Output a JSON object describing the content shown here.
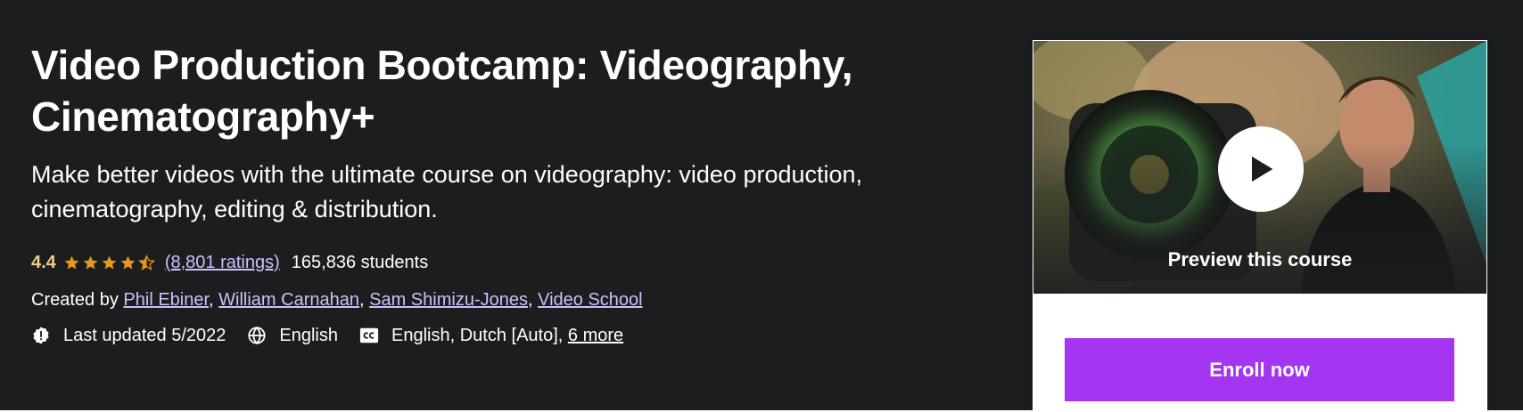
{
  "course": {
    "title": "Video Production Bootcamp: Videography, Cinematography+",
    "subtitle": "Make better videos with the ultimate course on videography: video production, cinematography, editing & distribution.",
    "rating": "4.4",
    "rating_value": 4.4,
    "rating_max": 5,
    "ratings_link": "(8,801 ratings)",
    "students": "165,836 students",
    "created_by_label": "Created by",
    "instructors": [
      "Phil Ebiner",
      "William Carnahan",
      "Sam Shimizu-Jones",
      "Video School"
    ],
    "separator": ",",
    "last_updated": "Last updated 5/2022",
    "language": "English",
    "captions": "English, Dutch [Auto],",
    "captions_more": "6 more"
  },
  "sidebar": {
    "preview_label": "Preview this course",
    "enroll_label": "Enroll now"
  },
  "icons": {
    "star": "star-icon",
    "updated": "alert-badge-icon",
    "language": "globe-icon",
    "captions": "closed-captions-icon",
    "play": "play-icon"
  },
  "colors": {
    "hero_background": "#1c1d1f",
    "rating_gold": "#f3ca8c",
    "star_gold": "#e59819",
    "link_lavender": "#cec0fc",
    "enroll_purple": "#a435f0",
    "teal_accent": "#2e9e9b"
  }
}
